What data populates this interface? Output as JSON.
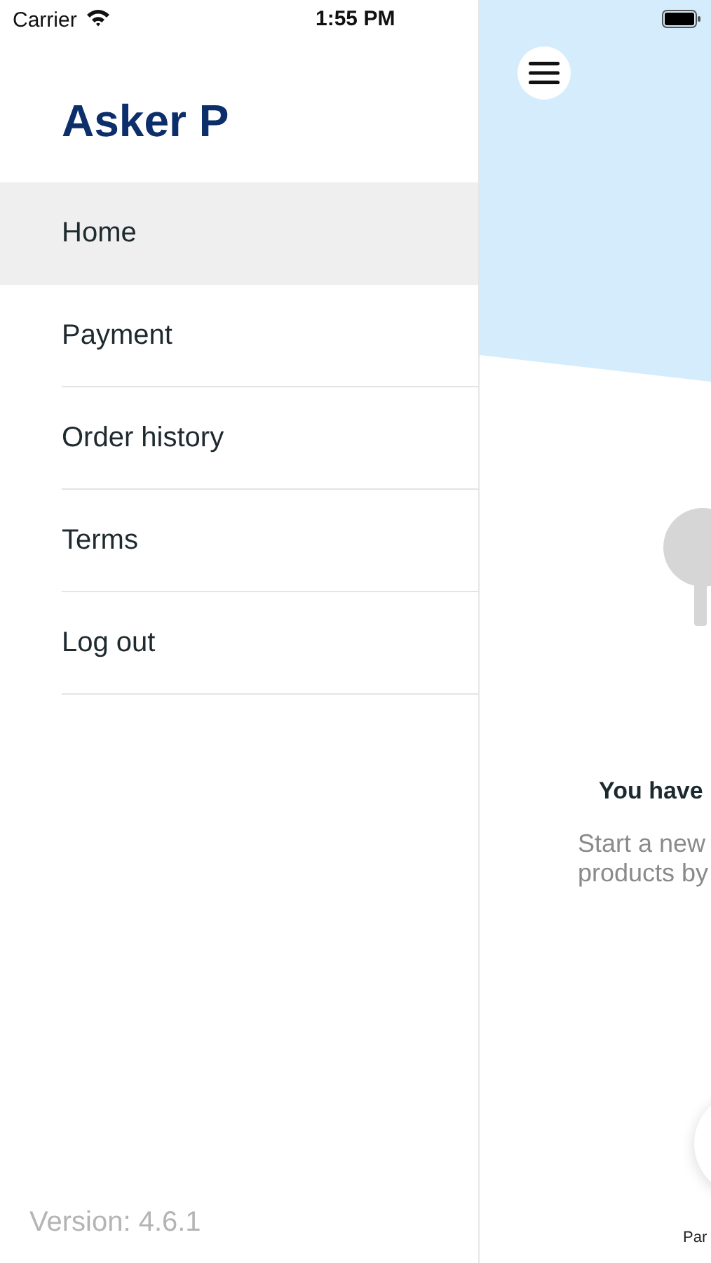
{
  "status_bar": {
    "carrier": "Carrier",
    "time": "1:55 PM"
  },
  "drawer": {
    "user_name": "Asker P",
    "items": [
      {
        "label": "Home",
        "selected": true
      },
      {
        "label": "Payment",
        "selected": false
      },
      {
        "label": "Order history",
        "selected": false
      },
      {
        "label": "Terms",
        "selected": false
      },
      {
        "label": "Log out",
        "selected": false
      }
    ],
    "version": "Version: 4.6.1"
  },
  "main": {
    "empty_title": "You have",
    "empty_text_lines": [
      "Start a new",
      "products by"
    ],
    "bottom_button_label": "Par"
  }
}
